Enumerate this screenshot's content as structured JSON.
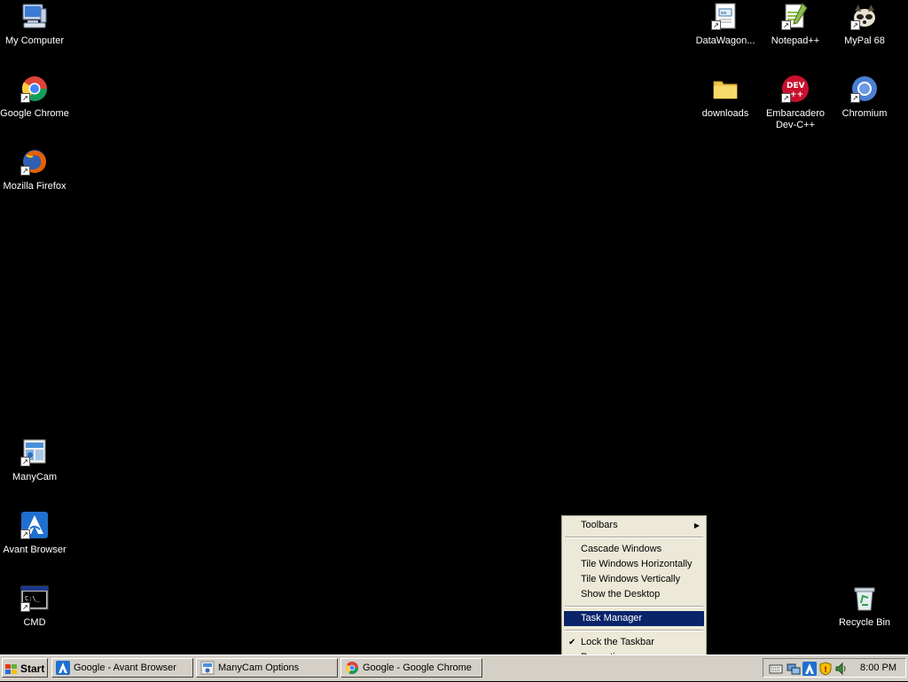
{
  "desktop": {
    "icons_left": [
      {
        "label": "My Computer",
        "icon": "my-computer-icon"
      },
      {
        "label": "Google Chrome",
        "icon": "chrome-icon"
      },
      {
        "label": "Mozilla Firefox",
        "icon": "firefox-icon"
      },
      {
        "label": "ManyCam",
        "icon": "manycam-icon"
      },
      {
        "label": "Avant Browser",
        "icon": "avant-browser-icon"
      },
      {
        "label": "CMD",
        "icon": "cmd-icon"
      }
    ],
    "icons_right": [
      {
        "label": "DataWagon...",
        "icon": "datawagon-icon"
      },
      {
        "label": "Notepad++",
        "icon": "notepadpp-icon"
      },
      {
        "label": "MyPal 68",
        "icon": "mypal-icon"
      },
      {
        "label": "downloads",
        "icon": "folder-icon"
      },
      {
        "label": "Embarcadero\nDev-C++",
        "icon": "devcpp-icon"
      },
      {
        "label": "Chromium",
        "icon": "chromium-icon"
      },
      {
        "label": "Recycle Bin",
        "icon": "recycle-bin-icon"
      }
    ]
  },
  "context_menu": {
    "items": [
      {
        "label": "Toolbars"
      },
      {
        "label": "Cascade Windows"
      },
      {
        "label": "Tile Windows Horizontally"
      },
      {
        "label": "Tile Windows Vertically"
      },
      {
        "label": "Show the Desktop"
      },
      {
        "label": "Task Manager"
      },
      {
        "label": "Lock the Taskbar"
      },
      {
        "label": "Properties"
      }
    ],
    "highlighted": "Task Manager",
    "checked": "Lock the Taskbar",
    "check_glyph": "✔",
    "submenu_arrow": "▶"
  },
  "taskbar": {
    "start_label": "Start",
    "tasks": [
      {
        "label": "Google - Avant Browser",
        "icon": "avant-browser-icon"
      },
      {
        "label": "ManyCam Options",
        "icon": "manycam-icon"
      },
      {
        "label": "Google - Google Chrome",
        "icon": "chrome-icon"
      }
    ],
    "clock": "8:00 PM",
    "tray_icons": [
      "keyboard-icon",
      "network-icon",
      "avant-tray-icon",
      "security-shield-icon",
      "volume-icon"
    ]
  },
  "colors": {
    "desktop_bg": "#000000",
    "menu_bg": "#ece9d8",
    "menu_highlight": "#0a246a",
    "taskbar_bg": "#d4d0c8"
  }
}
